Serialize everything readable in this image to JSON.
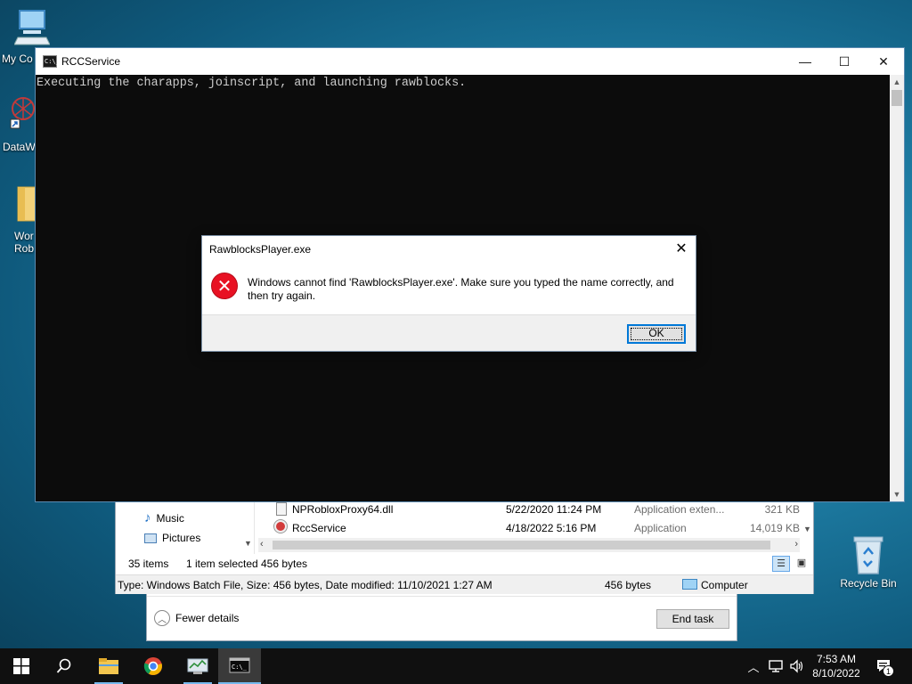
{
  "desktop": {
    "icons": [
      {
        "label": "My Co"
      },
      {
        "label": "DataW"
      },
      {
        "label": "Wor\nRob"
      },
      {
        "label": "Recycle Bin"
      }
    ]
  },
  "console": {
    "title": "RCCService",
    "output": "Executing the charapps, joinscript, and launching rawblocks.",
    "minimize": "—",
    "maximize": "☐",
    "close": "✕"
  },
  "dialog": {
    "title": "RawblocksPlayer.exe",
    "message": "Windows cannot find 'RawblocksPlayer.exe'. Make sure you typed the name correctly, and then try again.",
    "ok_label": "OK",
    "close": "✕"
  },
  "explorer": {
    "nav_items": [
      {
        "label": "Music"
      },
      {
        "label": "Pictures"
      }
    ],
    "files": [
      {
        "name": "NPRobloxProxy64.dll",
        "date": "5/22/2020 11:24 PM",
        "type": "Application exten...",
        "size": "321 KB"
      },
      {
        "name": "RccService",
        "date": "4/18/2022 5:16 PM",
        "type": "Application",
        "size": "14,019 KB"
      }
    ],
    "item_count": "35 items",
    "selected": "1 item selected",
    "selected_size": "456 bytes",
    "details": "Type: Windows Batch File, Size: 456 bytes, Date modified: 11/10/2021 1:27 AM",
    "details_size": "456 bytes",
    "location": "Computer"
  },
  "task_manager": {
    "fewer_details": "Fewer details",
    "end_task": "End task"
  },
  "taskbar": {
    "time": "7:53 AM",
    "date": "8/10/2022",
    "notification_count": "1"
  },
  "colors": {
    "accent": "#0078d7",
    "error": "#e81123",
    "console_bg": "#0c0c0c",
    "console_text": "#cccccc"
  }
}
